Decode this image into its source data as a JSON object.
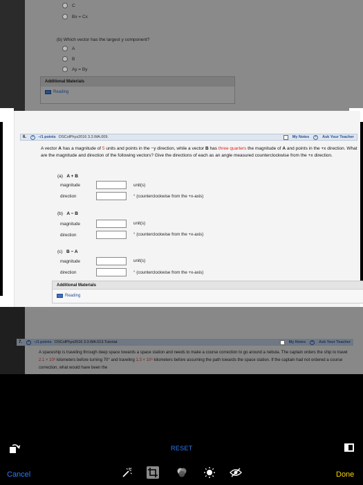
{
  "upper_question": {
    "options_prev": [
      "C",
      "Bx = Cx"
    ],
    "part_b_prompt": "(b) Which vector has the largest y component?",
    "options": [
      "A",
      "B",
      "Ay = By"
    ],
    "additional_materials": "Additional Materials",
    "reading": "Reading"
  },
  "question6": {
    "number": "6.",
    "points": "–/1 points",
    "code": "OSColPhys2016 3.3.WA.009.",
    "my_notes": "My Notes",
    "ask_teacher": "Ask Your Teacher",
    "prompt_1": "A vector",
    "vec_a": "A",
    "prompt_2": "has a magnitude of",
    "magnitude": "5",
    "prompt_3": "units and points in the −y direction, while a vector",
    "vec_b": "B",
    "prompt_4": "has",
    "fraction": "three quarters",
    "prompt_5": "the magnitude of",
    "prompt_6": "and points in the +x direction. What are the magnitude and direction of the following vectors? Give the directions of each as an angle measured counterclockwise from the +x direction.",
    "parts": [
      {
        "label": "(a)",
        "expr": "A + B",
        "magnitude_label": "magnitude",
        "magnitude_unit": "unit(s)",
        "direction_label": "direction",
        "direction_unit": "° (counterclockwise from the +x-axis)"
      },
      {
        "label": "(b)",
        "expr": "A − B",
        "magnitude_label": "magnitude",
        "magnitude_unit": "unit(s)",
        "direction_label": "direction",
        "direction_unit": "° (counterclockwise from the +x-axis)"
      },
      {
        "label": "(c)",
        "expr": "B − A",
        "magnitude_label": "magnitude",
        "magnitude_unit": "unit(s)",
        "direction_label": "direction",
        "direction_unit": "° (counterclockwise from the +x-axis)"
      }
    ],
    "additional_materials": "Additional Materials",
    "reading": "Reading"
  },
  "question7": {
    "number": "7.",
    "points": "–/1 points",
    "code": "OSColPhys2016 3.3.WA.013.Tutorial.",
    "my_notes": "My Notes",
    "ask_teacher": "Ask Your Teacher",
    "text_1": "A spaceship is traveling through deep space towards a space station and needs to make a course correction to go around a nebula. The captain orders the ship to travel",
    "dist_1": "2.1 × 10⁶",
    "text_2": "kilometers before turning 70° and traveling",
    "dist_2": "1.3 × 10⁶",
    "text_3": "kilometers before assuming the path towards the space station. If the captain had not ordered a course correction, what would have been the"
  },
  "toolbar": {
    "reset": "RESET",
    "cancel": "Cancel",
    "done": "Done",
    "icons": [
      "rotate-icon",
      "aspect-ratio-icon",
      "auto-enhance-icon",
      "crop-icon",
      "filters-icon",
      "adjust-icon",
      "markup-icon"
    ]
  },
  "colors": {
    "accent_blue": "#2e7cf6",
    "done_yellow": "#ffd400",
    "highlight_red": "#d22222",
    "link_blue": "#254f96"
  }
}
